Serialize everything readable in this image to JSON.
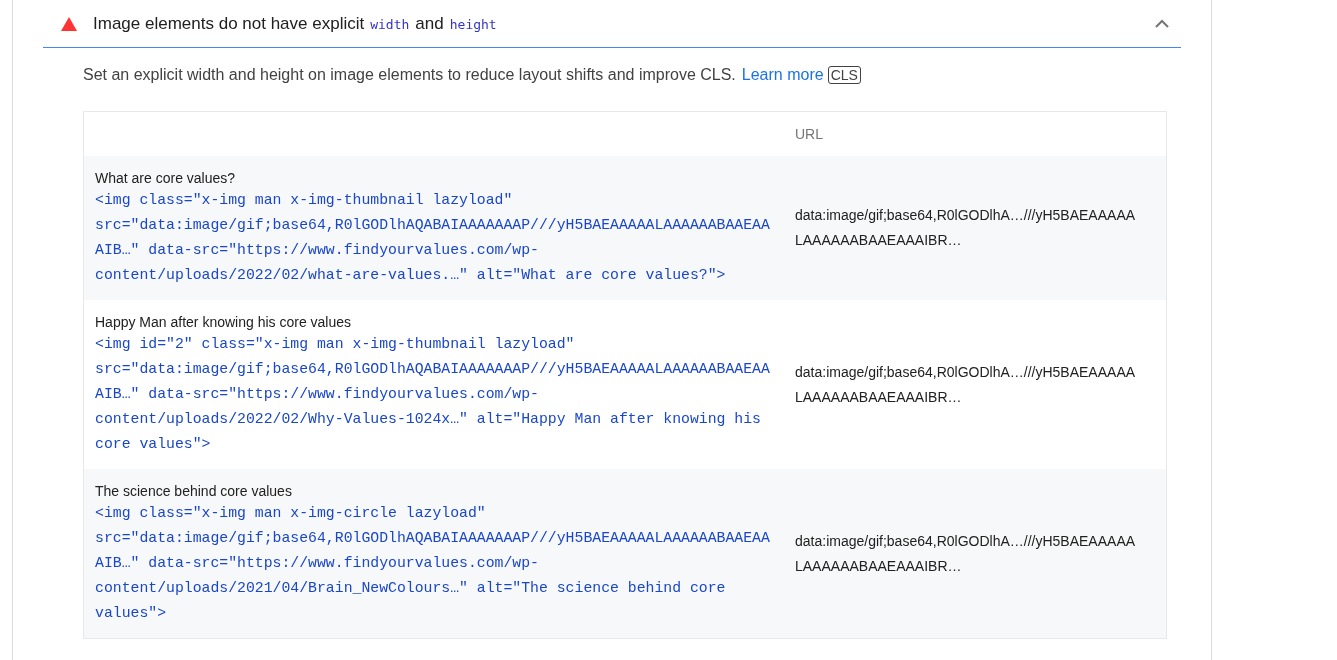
{
  "audit": {
    "color": "#ff3333",
    "expanded": true,
    "title_parts": [
      {
        "kind": "text",
        "text": "Image elements do not have explicit"
      },
      {
        "kind": "code",
        "text": "width"
      },
      {
        "kind": "text",
        "text": "and"
      },
      {
        "kind": "code",
        "text": "height"
      }
    ],
    "description": "Set an explicit width and height on image elements to reduce layout shifts and improve CLS.",
    "link": "Learn more",
    "badge": "CLS"
  },
  "table": {
    "columns": [
      "URL"
    ],
    "rows": [
      {
        "label": "What are core values?",
        "snippet": "<img class=\"x-img man x-img-thumbnail lazyload\" src=\"data:image/gif;base64,R0lGODlhAQABAIAAAAAAAP///yH5BAEAAAAALAAAAAABAAEAAAIB…\" data-src=\"https://www.findyourvalues.com/wp-content/uploads/2022/02/what-are-values.…\" alt=\"What are core values?\">",
        "url": "data:image/gif;base64,R0lGODlhA…///yH5BAEAAAAALAAAAAABAAEAAAIBR…"
      },
      {
        "label": "Happy Man after knowing his core values",
        "snippet": "<img id=\"2\" class=\"x-img man x-img-thumbnail lazyload\" src=\"data:image/gif;base64,R0lGODlhAQABAIAAAAAAAP///yH5BAEAAAAALAAAAAABAAEAAAIB…\" data-src=\"https://www.findyourvalues.com/wp-content/uploads/2022/02/Why-Values-1024x…\" alt=\"Happy Man after knowing his core values\">",
        "url": "data:image/gif;base64,R0lGODlhA…///yH5BAEAAAAALAAAAAABAAEAAAIBR…"
      },
      {
        "label": "The science behind core values",
        "snippet": "<img class=\"x-img man x-img-circle lazyload\" src=\"data:image/gif;base64,R0lGODlhAQABAIAAAAAAAP///yH5BAEAAAAALAAAAAABAAEAAAIB…\" data-src=\"https://www.findyourvalues.com/wp-content/uploads/2021/04/Brain_NewColours…\" alt=\"The science behind core values\">",
        "url": "data:image/gif;base64,R0lGODlhA…///yH5BAEAAAAALAAAAAABAAEAAAIBR…"
      }
    ]
  }
}
